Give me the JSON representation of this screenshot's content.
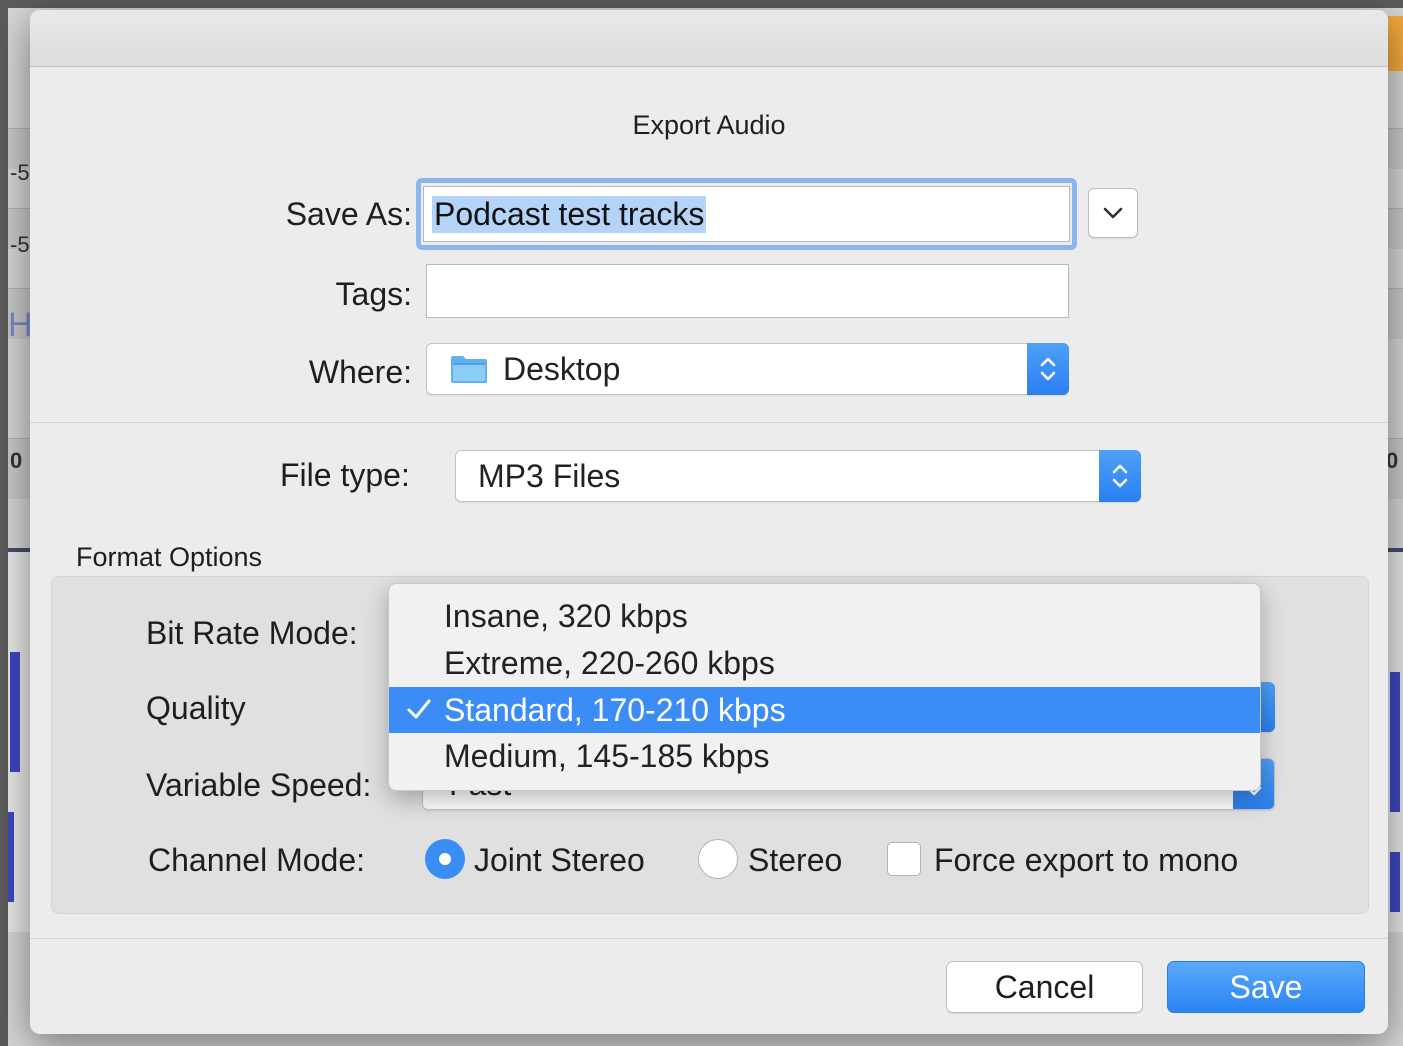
{
  "dialog": {
    "title": "Export Audio",
    "save_as": {
      "label": "Save As:",
      "value": "Podcast test tracks"
    },
    "tags": {
      "label": "Tags:",
      "value": ""
    },
    "where": {
      "label": "Where:",
      "value": "Desktop",
      "icon": "folder-icon"
    },
    "file_type": {
      "label": "File type:",
      "value": "MP3 Files"
    },
    "format_options": {
      "heading": "Format Options",
      "bit_rate_mode_label": "Bit Rate Mode:",
      "quality_label": "Quality",
      "variable_speed_label": "Variable Speed:",
      "variable_speed_value": "Fast",
      "channel_mode_label": "Channel Mode:",
      "channel_options": [
        {
          "label": "Joint Stereo",
          "selected": true
        },
        {
          "label": "Stereo",
          "selected": false
        }
      ],
      "force_mono": {
        "label": "Force export to mono",
        "checked": false
      }
    },
    "quality_menu": {
      "items": [
        {
          "label": "Insane, 320 kbps",
          "selected": false
        },
        {
          "label": "Extreme, 220-260 kbps",
          "selected": false
        },
        {
          "label": "Standard, 170-210 kbps",
          "selected": true
        },
        {
          "label": "Medium, 145-185 kbps",
          "selected": false
        }
      ]
    },
    "buttons": {
      "cancel": "Cancel",
      "save": "Save"
    }
  },
  "background": {
    "ruler_labels": [
      "-5",
      "-5",
      "H",
      "0",
      "0"
    ]
  },
  "colors": {
    "accent": "#3a8df5",
    "selection_highlight": "#b3d3f7",
    "dialog_bg": "#ececec"
  }
}
